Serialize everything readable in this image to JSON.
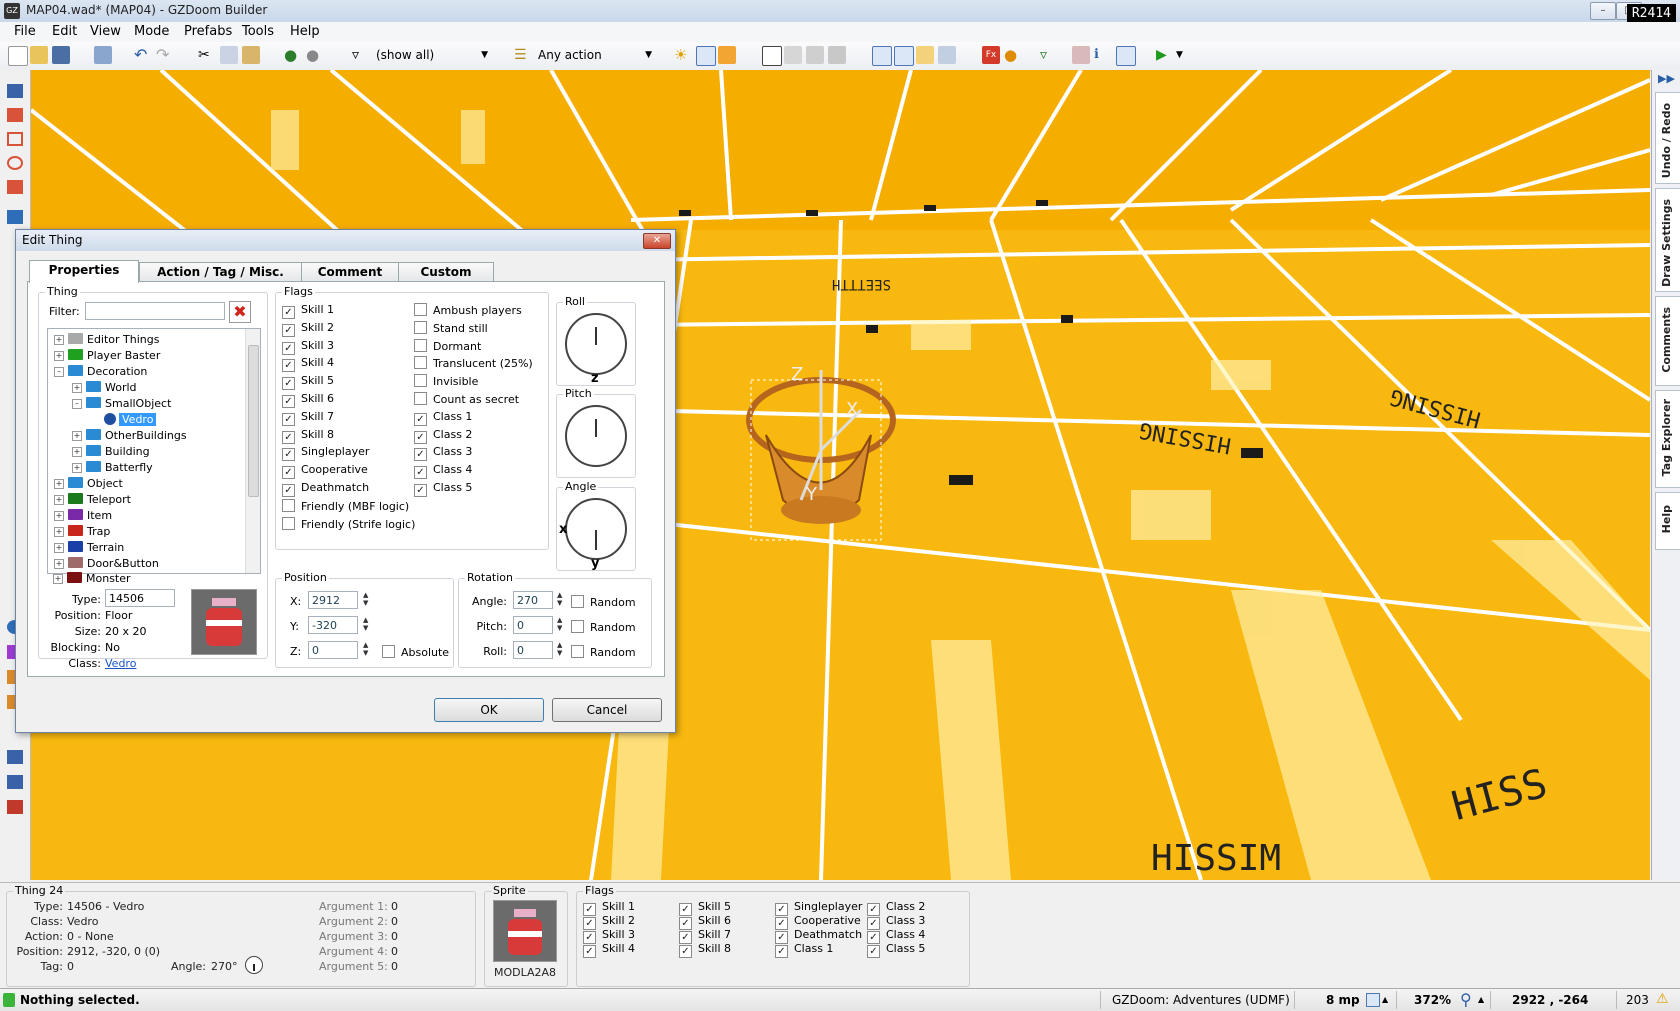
{
  "window": {
    "title": "MAP04.wad* (MAP04) - GZDoom Builder",
    "app_icon": "GZ",
    "badge": "R2414"
  },
  "menu": [
    "File",
    "Edit",
    "View",
    "Mode",
    "Prefabs",
    "Tools",
    "Help"
  ],
  "toolbar": {
    "filter_value": "(show all)",
    "action_value": "Any action"
  },
  "dock_tabs": [
    "Undo / Redo",
    "Draw Settings",
    "Comments",
    "Tag Explorer",
    "Help"
  ],
  "dialog": {
    "title": "Edit Thing",
    "tabs": [
      "Properties",
      "Action / Tag / Misc.",
      "Comment",
      "Custom"
    ],
    "thing": {
      "group_label": "Thing",
      "filter_label": "Filter:",
      "filter_value": "",
      "tree": [
        "Editor Things",
        "Player Baster",
        "Decoration",
        "World",
        "SmallObject",
        "Vedro",
        "OtherBuildings",
        "Building",
        "Batterfly",
        "Object",
        "Teleport",
        "Item",
        "Trap",
        "Terrain",
        "Door&Button",
        "Monster"
      ],
      "type_label": "Type:",
      "type_value": "14506",
      "position_label": "Position:",
      "position_value": "Floor",
      "size_label": "Size:",
      "size_value": "20 x 20",
      "blocking_label": "Blocking:",
      "blocking_value": "No",
      "class_label": "Class:",
      "class_value": "Vedro"
    },
    "flags": {
      "label": "Flags",
      "left": [
        {
          "label": "Skill 1",
          "checked": true
        },
        {
          "label": "Skill 2",
          "checked": true
        },
        {
          "label": "Skill 3",
          "checked": true
        },
        {
          "label": "Skill 4",
          "checked": true
        },
        {
          "label": "Skill 5",
          "checked": true
        },
        {
          "label": "Skill 6",
          "checked": true
        },
        {
          "label": "Skill 7",
          "checked": true
        },
        {
          "label": "Skill 8",
          "checked": true
        },
        {
          "label": "Singleplayer",
          "checked": true
        },
        {
          "label": "Cooperative",
          "checked": true
        },
        {
          "label": "Deathmatch",
          "checked": true
        },
        {
          "label": "Friendly (MBF logic)",
          "checked": false
        },
        {
          "label": "Friendly (Strife logic)",
          "checked": false
        }
      ],
      "right": [
        {
          "label": "Ambush players",
          "checked": false
        },
        {
          "label": "Stand still",
          "checked": false
        },
        {
          "label": "Dormant",
          "checked": false
        },
        {
          "label": "Translucent (25%)",
          "checked": false
        },
        {
          "label": "Invisible",
          "checked": false
        },
        {
          "label": "Count as secret",
          "checked": false
        },
        {
          "label": "Class 1",
          "checked": true
        },
        {
          "label": "Class 2",
          "checked": true
        },
        {
          "label": "Class 3",
          "checked": true
        },
        {
          "label": "Class 4",
          "checked": true
        },
        {
          "label": "Class 5",
          "checked": true
        }
      ]
    },
    "dials": {
      "roll_label": "Roll",
      "roll_axis": "z",
      "pitch_label": "Pitch",
      "angle_label": "Angle",
      "angle_axis_x": "x",
      "angle_axis_y": "y"
    },
    "position": {
      "label": "Position",
      "x_label": "X:",
      "x_value": "2912",
      "y_label": "Y:",
      "y_value": "-320",
      "z_label": "Z:",
      "z_value": "0",
      "absolute_label": "Absolute"
    },
    "rotation": {
      "label": "Rotation",
      "angle_label": "Angle:",
      "angle_value": "270",
      "pitch_label": "Pitch:",
      "pitch_value": "0",
      "roll_label": "Roll:",
      "roll_value": "0",
      "random_label": "Random"
    },
    "ok_label": "OK",
    "cancel_label": "Cancel"
  },
  "info": {
    "title": "Thing 24",
    "type_label": "Type:",
    "type_value": "14506 - Vedro",
    "class_label": "Class:",
    "class_value": "Vedro",
    "action_label": "Action:",
    "action_value": "0 - None",
    "position_label": "Position:",
    "position_value": "2912, -320, 0 (0)",
    "tag_label": "Tag:",
    "tag_value": "0",
    "angle_label": "Angle:",
    "angle_value": "270°",
    "arguments": [
      {
        "label": "Argument 1:",
        "value": "0"
      },
      {
        "label": "Argument 2:",
        "value": "0"
      },
      {
        "label": "Argument 3:",
        "value": "0"
      },
      {
        "label": "Argument 4:",
        "value": "0"
      },
      {
        "label": "Argument 5:",
        "value": "0"
      }
    ],
    "sprite_label": "Sprite",
    "sprite_name": "MODLA2A8",
    "flags_label": "Flags",
    "flags": [
      "Skill 1",
      "Skill 2",
      "Skill 3",
      "Skill 4",
      "Skill 5",
      "Skill 6",
      "Skill 7",
      "Skill 8",
      "Singleplayer",
      "Cooperative",
      "Deathmatch",
      "Class 1",
      "Class 2",
      "Class 3",
      "Class 4",
      "Class 5"
    ]
  },
  "status": {
    "message": "Nothing selected.",
    "config": "GZDoom: Adventures (UDMF)",
    "grid": "8 mp",
    "zoom": "372%",
    "coords": "2922 , -264",
    "count": "203"
  },
  "colors": {
    "floor": "#f8b80f",
    "stripe": "#ffffff",
    "accent": "#2f6db8",
    "selection": "#3399ff"
  }
}
